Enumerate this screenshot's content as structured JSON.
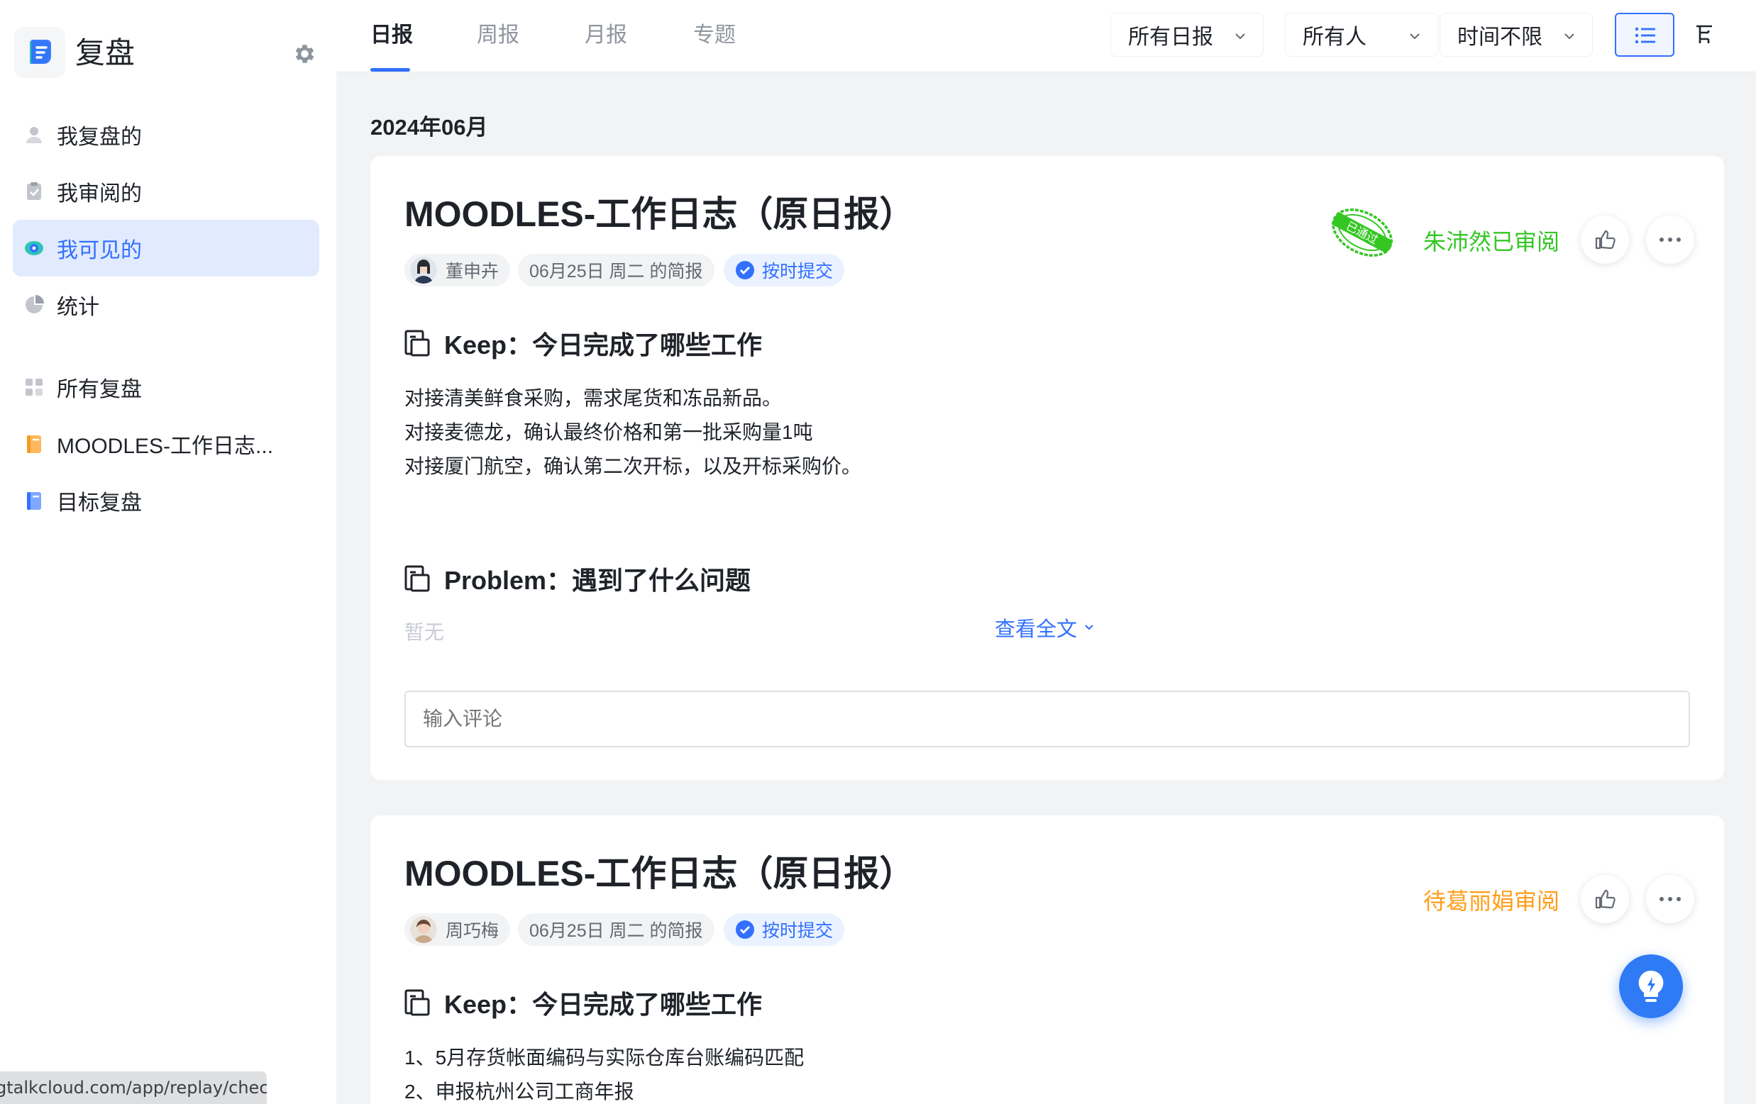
{
  "sidebar": {
    "brand_title": "复盘",
    "nav_primary": [
      {
        "label": "我复盘的",
        "icon": "user-icon"
      },
      {
        "label": "我审阅的",
        "icon": "clipboard-check-icon"
      },
      {
        "label": "我可见的",
        "icon": "eye-icon",
        "active": true
      },
      {
        "label": "统计",
        "icon": "pie-chart-icon"
      }
    ],
    "nav_secondary": [
      {
        "label": "所有复盘",
        "icon": "grid-icon"
      },
      {
        "label": "MOODLES-工作日志...",
        "icon": "notebook-orange-icon"
      },
      {
        "label": "目标复盘",
        "icon": "notebook-blue-icon"
      }
    ]
  },
  "topbar": {
    "tabs": [
      {
        "label": "日报",
        "active": true
      },
      {
        "label": "周报"
      },
      {
        "label": "月报"
      },
      {
        "label": "专题"
      }
    ],
    "filters": {
      "type": "所有日报",
      "person": "所有人",
      "time": "时间不限"
    },
    "view_modes": [
      "list-view-icon",
      "tree-view-icon"
    ]
  },
  "month_label": "2024年06月",
  "cards": [
    {
      "title": "MOODLES-工作日志（原日报）",
      "author": "董申卉",
      "date_chip": "06月25日 周二 的简报",
      "ontime_chip": "按时提交",
      "review_status": "朱沛然已审阅",
      "stamp_text": "已通过",
      "keep_key": "Keep：",
      "keep_title": "今日完成了哪些工作",
      "keep_lines": [
        "对接清美鲜食采购，需求尾货和冻品新品。",
        "对接麦德龙，确认最终价格和第一批采购量1吨",
        "对接厦门航空，确认第二次开标，以及开标采购价。"
      ],
      "problem_key": "Problem：",
      "problem_title": "遇到了什么问题",
      "problem_text": "暂无",
      "expand_label": "查看全文",
      "comment_placeholder": "输入评论"
    },
    {
      "title": "MOODLES-工作日志（原日报）",
      "author": "周巧梅",
      "date_chip": "06月25日 周二 的简报",
      "ontime_chip": "按时提交",
      "review_status": "待葛丽娟审阅",
      "keep_key": "Keep：",
      "keep_title": "今日完成了哪些工作",
      "keep_lines": [
        "1、5月存货帐面编码与实际仓库台账编码匹配",
        "2、申报杭州公司工商年报"
      ]
    }
  ],
  "status_url": "gtalkcloud.com/app/replay/check",
  "colors": {
    "accent": "#3370ff",
    "reviewed": "#34c724",
    "pending": "#ff9e1a"
  }
}
